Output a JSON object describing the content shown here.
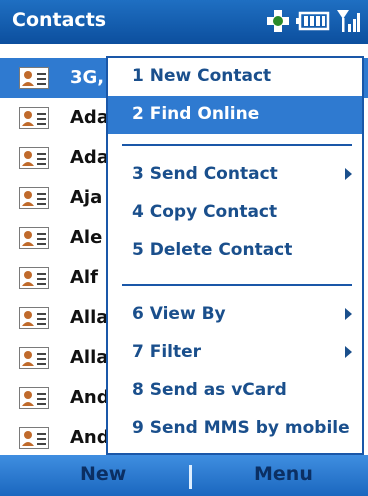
{
  "header": {
    "title": "Contacts"
  },
  "contacts": [
    {
      "name": "3G,"
    },
    {
      "name": "Ada"
    },
    {
      "name": "Ada"
    },
    {
      "name": "Aja"
    },
    {
      "name": "Ale"
    },
    {
      "name": "Alf"
    },
    {
      "name": "Alla"
    },
    {
      "name": "Alla"
    },
    {
      "name": "And"
    },
    {
      "name": "And"
    }
  ],
  "menu": {
    "items": [
      {
        "label": "1 New Contact"
      },
      {
        "label": "2 Find Online"
      },
      {
        "label": "3 Send Contact"
      },
      {
        "label": "4 Copy Contact"
      },
      {
        "label": "5 Delete Contact"
      },
      {
        "label": "6 View By"
      },
      {
        "label": "7 Filter"
      },
      {
        "label": "8 Send as vCard"
      },
      {
        "label": "9 Send MMS by mobile"
      }
    ]
  },
  "softkeys": {
    "left": "New",
    "right": "Menu"
  },
  "colors": {
    "accent": "#2f7ad0",
    "menu_border": "#1a57a8",
    "titlebar": "#0c4f9e"
  },
  "icons": [
    "bluetooth-icon",
    "battery-icon",
    "signal-icon",
    "contact-card-icon"
  ]
}
